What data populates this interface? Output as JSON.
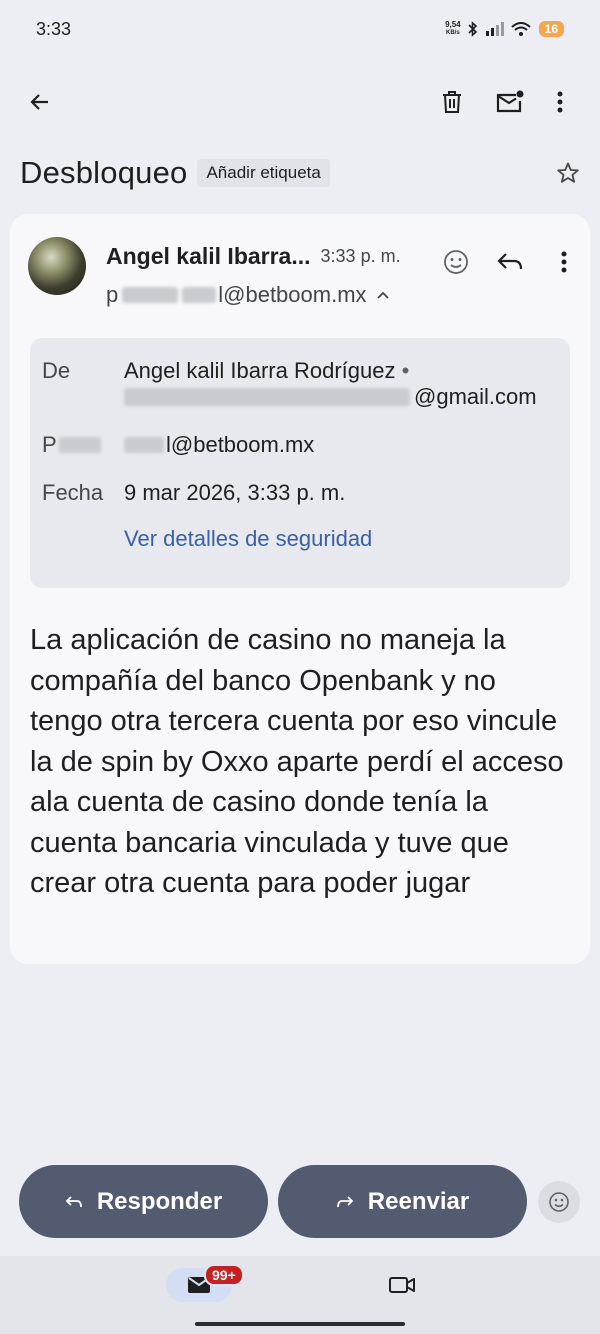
{
  "status_bar": {
    "time": "3:33",
    "net_speed_value": "9,54",
    "net_speed_unit": "KB/s",
    "battery": "16"
  },
  "subject": {
    "title": "Desbloqueo",
    "add_label": "Añadir etiqueta"
  },
  "message": {
    "sender_name": "Angel kalil Ibarra...",
    "time": "3:33 p. m.",
    "recipient_visible": "@betboom.mx",
    "recipient_start": "p",
    "recipient_last": "l",
    "details": {
      "from_label": "De",
      "from_name": "Angel kalil Ibarra Rodríguez",
      "from_email_visible": "@gmail.com",
      "to_label_start": "P",
      "to_value_visible": "l@betboom.mx",
      "date_label": "Fecha",
      "date_value": "9 mar 2026, 3:33 p. m.",
      "security_link": "Ver detalles de seguridad"
    },
    "body": "La aplicación de casino no maneja la compañía del banco Openbank y no tengo otra tercera cuenta por eso vincule la de spin by Oxxo aparte perdí el acceso ala cuenta de casino donde tenía la cuenta bancaria vinculada y tuve que crear otra cuenta para poder jugar"
  },
  "actions": {
    "reply": "Responder",
    "forward": "Reenviar"
  },
  "bottom_nav": {
    "mail_badge": "99+"
  }
}
